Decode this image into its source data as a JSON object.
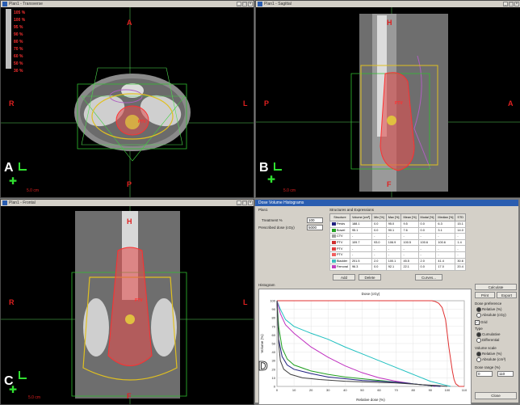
{
  "panes": {
    "transverse": {
      "title": "Plan1 - Transverse",
      "letter": "A",
      "scale": "5.0 cm"
    },
    "sagittal": {
      "title": "Plan1 - Sagittal",
      "letter": "B",
      "scale": "5.0 cm"
    },
    "frontal": {
      "title": "Plan1 - Frontal",
      "letter": "C",
      "scale": "5.0 cm"
    },
    "dvh_letter": "D"
  },
  "orientation": {
    "A": "A",
    "P": "P",
    "R": "R",
    "L": "L",
    "H": "H",
    "F": "F"
  },
  "isodose_legend": [
    "105 %",
    "100 %",
    "95 %",
    "90 %",
    "80 %",
    "70 %",
    "60 %",
    "50 %",
    "30 %"
  ],
  "structure_labels": {
    "ptv": "PTV"
  },
  "dvh": {
    "window_title": "Dose Volume Histograms",
    "plan_label": "Plan1",
    "treatment_label": "Treatment %",
    "treatment_value": "100",
    "prescribed_label": "Prescribed dose (cGy)",
    "prescribed_value": "5000",
    "structures_heading": "Structures and Expressions",
    "columns": [
      "Structure",
      "Volume [cm³]",
      "Min [%]",
      "Max [%]",
      "Mean [%]",
      "Modal [%]",
      "Median [%]",
      "STD"
    ],
    "rows": [
      {
        "color": "#202080",
        "cells": [
          "Pelvis",
          "188.1",
          "0.0",
          "95.0",
          "9.5",
          "0.0",
          "6.3",
          "15.1"
        ]
      },
      {
        "color": "#20a020",
        "cells": [
          "Bowel",
          "95.1",
          "0.0",
          "90.1",
          "7.6",
          "0.0",
          "3.1",
          "14.0"
        ]
      },
      {
        "color": "#a0a0a0",
        "cells": [
          "CTV",
          "-",
          "-",
          "-",
          "-",
          "-",
          "-",
          "-"
        ]
      },
      {
        "color": "#d03030",
        "cells": [
          "PTV",
          "109.7",
          "93.0",
          "106.9",
          "100.5",
          "100.6",
          "100.6",
          "1.4"
        ]
      },
      {
        "color": "#e04040",
        "cells": [
          "PTV",
          "-",
          "-",
          "-",
          "-",
          "-",
          "-",
          "-"
        ]
      },
      {
        "color": "#f06060",
        "cells": [
          "PTV",
          "-",
          "-",
          "-",
          "-",
          "-",
          "-",
          "-"
        ]
      },
      {
        "color": "#40c0c0",
        "cells": [
          "Bladder",
          "201.5",
          "2.0",
          "100.1",
          "45.5",
          "2.0",
          "41.4",
          "30.6"
        ]
      },
      {
        "color": "#c040c0",
        "cells": [
          "Femoral",
          "96.3",
          "0.0",
          "92.1",
          "22.1",
          "0.0",
          "17.0",
          "20.4"
        ]
      }
    ],
    "add_button": "Add",
    "delete_button": "Delete",
    "curves_button": "Curves...",
    "histogram_heading": "Histogram",
    "plot_title": "Dose (cGy)",
    "xlabel": "Relative dose (%)",
    "ylabel": "Volume (%)",
    "side": {
      "calc_button": "Calculate",
      "print_button": "Print",
      "export_button": "Export",
      "dose_pref_label": "Dose preference",
      "dose_opts": [
        "Relative (%)",
        "Absolute (cGy)"
      ],
      "grid_label": "Grid",
      "type_label": "Type",
      "type_opts": [
        "Cumulative",
        "Differential"
      ],
      "volume_label": "Volume scale",
      "volume_opts": [
        "Relative (%)",
        "Absolute (cm³)"
      ],
      "range_label": "Dose range (%)",
      "range_from": "0",
      "range_to": "110",
      "close_button": "Close"
    }
  },
  "chart_data": {
    "type": "line",
    "title": "Dose (cGy)",
    "xlabel": "Relative dose (%)",
    "ylabel": "Volume (%)",
    "xlim": [
      0,
      110
    ],
    "ylim": [
      0,
      100
    ],
    "series": [
      {
        "name": "PTV",
        "color": "#e03030",
        "x": [
          0,
          91,
          93,
          95,
          97,
          99,
          101,
          103,
          104,
          105,
          107,
          110
        ],
        "y": [
          100,
          100,
          99,
          97,
          92,
          78,
          45,
          18,
          8,
          3,
          0,
          0
        ]
      },
      {
        "name": "Bladder",
        "color": "#20c0c0",
        "x": [
          0,
          2,
          5,
          10,
          20,
          30,
          40,
          50,
          60,
          70,
          80,
          90,
          100,
          102
        ],
        "y": [
          100,
          90,
          78,
          70,
          62,
          55,
          46,
          38,
          30,
          22,
          14,
          6,
          1,
          0
        ]
      },
      {
        "name": "Femoral",
        "color": "#c030c0",
        "x": [
          0,
          2,
          5,
          10,
          15,
          20,
          30,
          40,
          50,
          60,
          70,
          80,
          90,
          93
        ],
        "y": [
          100,
          85,
          72,
          62,
          54,
          46,
          34,
          24,
          16,
          10,
          6,
          3,
          1,
          0
        ]
      },
      {
        "name": "Bowel",
        "color": "#20a020",
        "x": [
          0,
          1,
          3,
          6,
          10,
          20,
          30,
          40,
          50,
          60,
          70,
          80,
          90,
          91
        ],
        "y": [
          100,
          70,
          45,
          32,
          25,
          18,
          14,
          11,
          9,
          7,
          5,
          3,
          1,
          0
        ]
      },
      {
        "name": "Pelvis",
        "color": "#202080",
        "x": [
          0,
          1,
          3,
          6,
          10,
          20,
          30,
          40,
          50,
          60,
          70,
          80,
          90,
          96
        ],
        "y": [
          100,
          55,
          35,
          25,
          20,
          15,
          11,
          9,
          7,
          6,
          5,
          3,
          1,
          0
        ]
      },
      {
        "name": "Body",
        "color": "#404040",
        "x": [
          0,
          1,
          2,
          4,
          8,
          15,
          25,
          40,
          55,
          70,
          85,
          95,
          100
        ],
        "y": [
          100,
          50,
          30,
          20,
          14,
          10,
          8,
          6,
          5,
          4,
          2,
          1,
          0
        ]
      }
    ]
  }
}
